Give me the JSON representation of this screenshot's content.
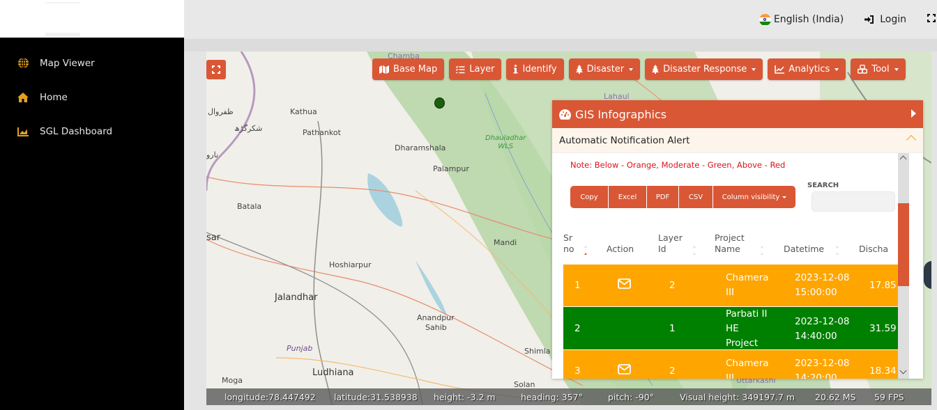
{
  "sidebar": {
    "items": [
      {
        "label": "Map Viewer",
        "icon": "globe-icon"
      },
      {
        "label": "Home",
        "icon": "home-icon"
      },
      {
        "label": "SGL Dashboard",
        "icon": "chart-area-icon"
      }
    ],
    "accent_color": "#e0a020"
  },
  "header": {
    "language": "English (India)",
    "login": "Login",
    "fullscreen_icon": "expand-icon"
  },
  "map": {
    "labels": {
      "kathua": "Kathua",
      "pathankot": "Pathankot",
      "dharamshala": "Dharamshala",
      "palampur": "Palampur",
      "dhauladhar": "Dhauladhar",
      "wls": "WLS",
      "batala": "Batala",
      "sar": "sar",
      "hoshiarpur": "Hoshiarpur",
      "jalandhar": "Jalandhar",
      "anandpur": "Anandpur",
      "sahib": "Sahib",
      "mandi": "Mandi",
      "punjab": "Punjab",
      "ludhiana": "Ludhiana",
      "moga": "Moga",
      "shimla": "Shimla",
      "solan": "Solan",
      "chamba": "Chamba",
      "lahaul": "Lahaul",
      "uttarkashi": "Uttarkashi",
      "urdu1": "ظفروال",
      "urdu2": "شکرگڑھ",
      "urdu3": "نارو"
    },
    "toolbar": [
      {
        "label": "Base Map",
        "icon": "map-icon",
        "dropdown": false
      },
      {
        "label": "Layer",
        "icon": "list-check-icon",
        "dropdown": false
      },
      {
        "label": "Identify",
        "icon": "info-icon",
        "dropdown": false
      },
      {
        "label": "Disaster",
        "icon": "tree-icon",
        "dropdown": true
      },
      {
        "label": "Disaster Response",
        "icon": "tree-icon",
        "dropdown": true
      },
      {
        "label": "Analytics",
        "icon": "chart-line-icon",
        "dropdown": true
      },
      {
        "label": "Tool",
        "icon": "cubes-icon",
        "dropdown": true
      }
    ],
    "accent_color": "#d95735"
  },
  "panel": {
    "title": "GIS Infographics",
    "section_title": "Automatic Notification Alert",
    "note": "Note: Below - Orange, Moderate - Green, Above - Red",
    "buttons": [
      "Copy",
      "Excel",
      "PDF",
      "CSV",
      "Column visibility"
    ],
    "search_label": "SEARCH",
    "search_value": "",
    "columns": [
      {
        "l1": "Sr",
        "l2": "no"
      },
      {
        "l1": "",
        "l2": "Action"
      },
      {
        "l1": "Layer",
        "l2": "Id"
      },
      {
        "l1": "Project",
        "l2": "Name"
      },
      {
        "l1": "",
        "l2": "Datetime"
      },
      {
        "l1": "",
        "l2": "Discha"
      }
    ],
    "rows": [
      {
        "sr": "1",
        "action": "mail",
        "layer": "2",
        "name_lines": [
          "Chamera",
          "III"
        ],
        "date": "2023-12-08",
        "time": "15:00:00",
        "discharge": "17.85",
        "status": "below",
        "color": "#ffa500"
      },
      {
        "sr": "2",
        "action": "",
        "layer": "1",
        "name_lines": [
          "Parbati II",
          "HE",
          "Project"
        ],
        "date": "2023-12-08",
        "time": "14:40:00",
        "discharge": "31.59",
        "status": "moderate",
        "color": "#008000"
      },
      {
        "sr": "3",
        "action": "mail",
        "layer": "2",
        "name_lines": [
          "Chamera",
          "III"
        ],
        "date": "2023-12-08",
        "time": "14:20:00",
        "discharge": "18.34",
        "status": "below",
        "color": "#ffa500"
      }
    ]
  },
  "status": {
    "longitude": "longitude:78.447492",
    "latitude": "latitude:31.538938",
    "height": "height: -3.2 m",
    "heading": "heading: 357°",
    "pitch": "pitch: -90°",
    "visual_height": "Visual height: 349197.7 m",
    "ms": "20.62 MS",
    "fps": "59 FPS"
  }
}
